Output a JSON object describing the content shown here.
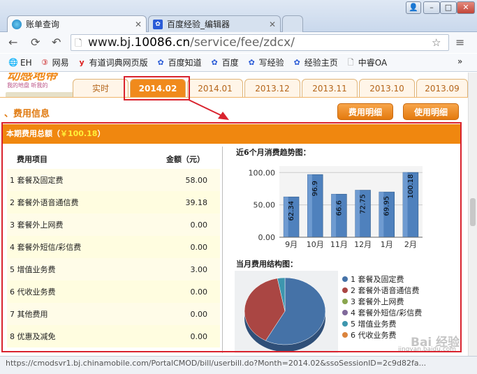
{
  "browser": {
    "tabs": [
      {
        "title": "账单查询",
        "active": true
      },
      {
        "title": "百度经验_编辑器",
        "active": false
      }
    ],
    "url_prefix": "www.bj.",
    "url_domain": "10086.cn",
    "url_path": "/service/fee/zdcx/",
    "bookmarks": [
      "EH",
      "网易",
      "有道词典网页版",
      "百度知道",
      "百度",
      "写经验",
      "经验主页",
      "中睿OA"
    ],
    "bookmarks_more": "»",
    "status_url": "https://cmodsvr1.bj.chinamobile.com/PortalCMOD/bill/userbill.do?Month=2014.02&ssoSessionID=2c9d82fa..."
  },
  "page": {
    "logo_text": "动感地带",
    "logo_tagline": "我的地盘 听我的",
    "month_tabs": [
      "实时",
      "2014.02",
      "2014.01",
      "2013.12",
      "2013.11",
      "2013.10",
      "2013.09"
    ],
    "selected_month": "2014.02",
    "section_title": "费用信息",
    "buttons": {
      "fee_detail": "费用明细",
      "usage_detail": "使用明细"
    },
    "summary_label": "本期费用总额（",
    "summary_amount": "￥100.18",
    "summary_close": "）",
    "table": {
      "headers": [
        "费用项目",
        "金额（元）"
      ],
      "rows": [
        {
          "name": "1 套餐及固定费",
          "amount": "58.00"
        },
        {
          "name": "2 套餐外语音通信费",
          "amount": "39.18"
        },
        {
          "name": "3 套餐外上网费",
          "amount": "0.00"
        },
        {
          "name": "4 套餐外短信/彩信费",
          "amount": "0.00"
        },
        {
          "name": "5 增值业务费",
          "amount": "3.00"
        },
        {
          "name": "6 代收业务费",
          "amount": "0.00"
        },
        {
          "name": "7 其他费用",
          "amount": "0.00"
        },
        {
          "name": "8 优惠及减免",
          "amount": "0.00"
        }
      ]
    },
    "trend_title": "近6个月消费趋势图：",
    "structure_title": "当月费用结构图：",
    "watermark": "Bai 经验",
    "watermark_url": "jingyan.baidu.com"
  },
  "chart_data": [
    {
      "type": "bar",
      "title": "近6个月消费趋势图：",
      "categories": [
        "9月",
        "10月",
        "11月",
        "12月",
        "1月",
        "2月"
      ],
      "values": [
        62.34,
        96.9,
        66.6,
        72.75,
        69.95,
        100.18
      ],
      "value_labels": [
        "62.34",
        "96.9",
        "66.6",
        "72.75",
        "69.95",
        "100.18"
      ],
      "yticks": [
        "0.00",
        "50.00",
        "100.00"
      ],
      "ylim": [
        0,
        110
      ],
      "color": "#4f81bd"
    },
    {
      "type": "pie",
      "title": "当月费用结构图：",
      "labels": [
        "1 套餐及固定费",
        "2 套餐外语音通信费",
        "3 套餐外上网费",
        "4 套餐外短信/彩信费",
        "5 增值业务费",
        "6 代收业务费"
      ],
      "values": [
        58.0,
        39.18,
        0,
        0,
        3.0,
        0
      ],
      "colors": [
        "#4572a7",
        "#aa4643",
        "#89a54e",
        "#80699b",
        "#3d96ae",
        "#db843d"
      ],
      "legend": "right"
    }
  ]
}
